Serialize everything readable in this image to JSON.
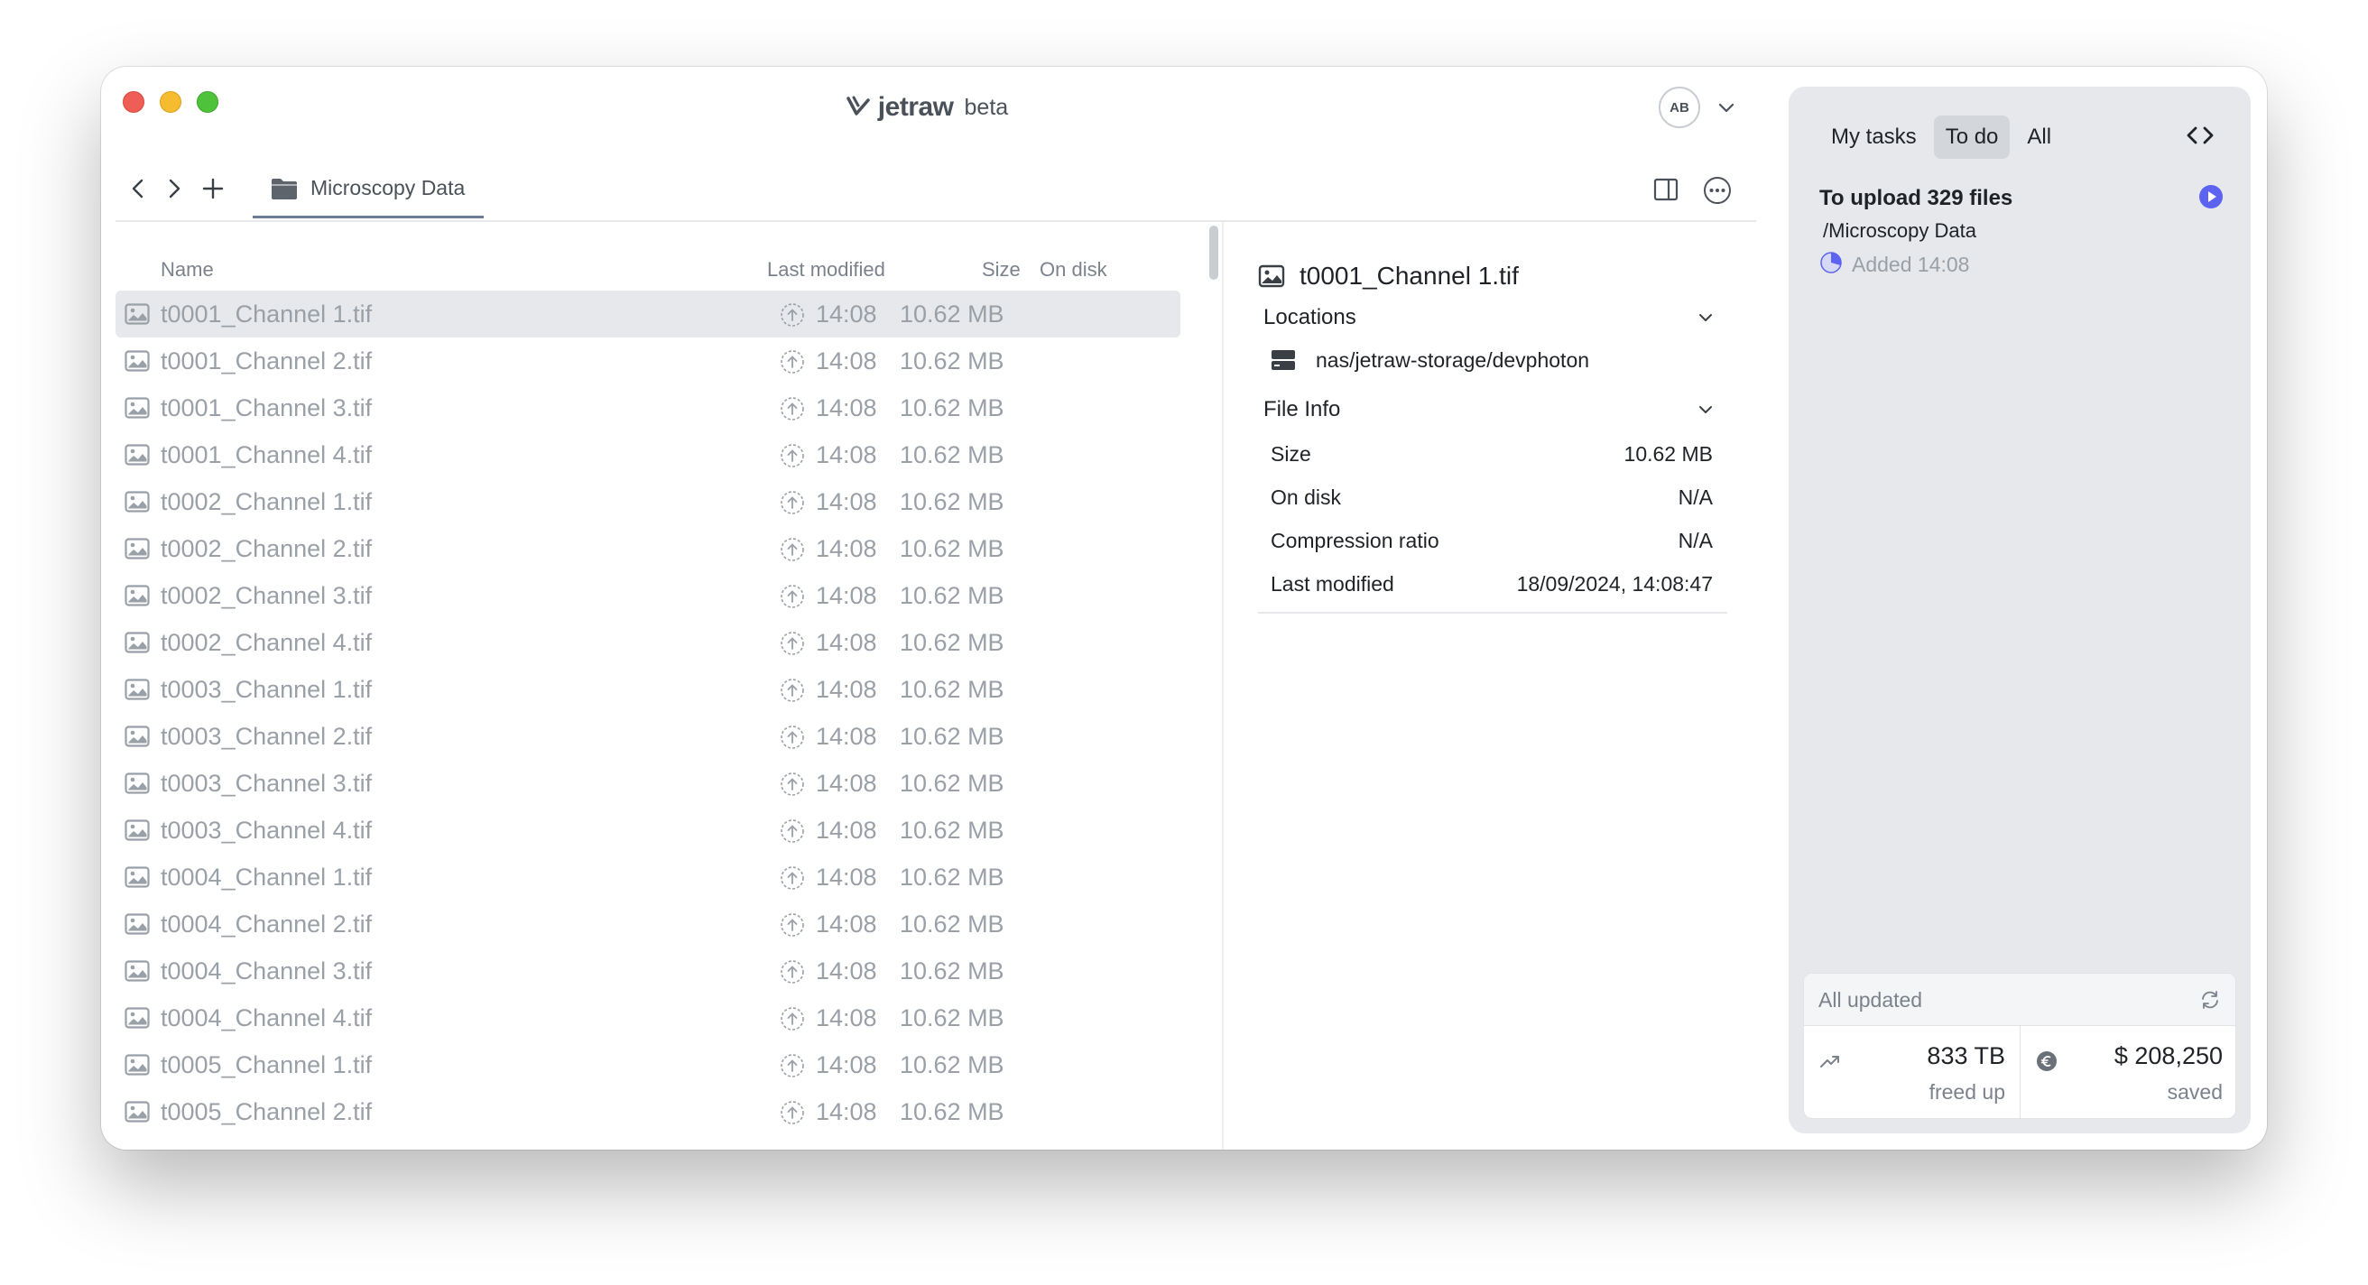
{
  "app": {
    "name": "jetraw",
    "badge": "beta",
    "user_initials": "AB"
  },
  "toolbar": {
    "tab_label": "Microscopy Data"
  },
  "file_list": {
    "columns": {
      "name": "Name",
      "last_modified": "Last modified",
      "size": "Size",
      "on_disk": "On disk"
    },
    "rows": [
      {
        "name": "t0001_Channel 1.tif",
        "time": "14:08",
        "size": "10.62 MB"
      },
      {
        "name": "t0001_Channel 2.tif",
        "time": "14:08",
        "size": "10.62 MB"
      },
      {
        "name": "t0001_Channel 3.tif",
        "time": "14:08",
        "size": "10.62 MB"
      },
      {
        "name": "t0001_Channel 4.tif",
        "time": "14:08",
        "size": "10.62 MB"
      },
      {
        "name": "t0002_Channel 1.tif",
        "time": "14:08",
        "size": "10.62 MB"
      },
      {
        "name": "t0002_Channel 2.tif",
        "time": "14:08",
        "size": "10.62 MB"
      },
      {
        "name": "t0002_Channel 3.tif",
        "time": "14:08",
        "size": "10.62 MB"
      },
      {
        "name": "t0002_Channel 4.tif",
        "time": "14:08",
        "size": "10.62 MB"
      },
      {
        "name": "t0003_Channel 1.tif",
        "time": "14:08",
        "size": "10.62 MB"
      },
      {
        "name": "t0003_Channel 2.tif",
        "time": "14:08",
        "size": "10.62 MB"
      },
      {
        "name": "t0003_Channel 3.tif",
        "time": "14:08",
        "size": "10.62 MB"
      },
      {
        "name": "t0003_Channel 4.tif",
        "time": "14:08",
        "size": "10.62 MB"
      },
      {
        "name": "t0004_Channel 1.tif",
        "time": "14:08",
        "size": "10.62 MB"
      },
      {
        "name": "t0004_Channel 2.tif",
        "time": "14:08",
        "size": "10.62 MB"
      },
      {
        "name": "t0004_Channel 3.tif",
        "time": "14:08",
        "size": "10.62 MB"
      },
      {
        "name": "t0004_Channel 4.tif",
        "time": "14:08",
        "size": "10.62 MB"
      },
      {
        "name": "t0005_Channel 1.tif",
        "time": "14:08",
        "size": "10.62 MB"
      },
      {
        "name": "t0005_Channel 2.tif",
        "time": "14:08",
        "size": "10.62 MB"
      }
    ]
  },
  "detail": {
    "title": "t0001_Channel 1.tif",
    "locations_label": "Locations",
    "location_path": "nas/jetraw-storage/devphoton",
    "file_info_label": "File Info",
    "info": [
      {
        "label": "Size",
        "value": "10.62 MB"
      },
      {
        "label": "On disk",
        "value": "N/A"
      },
      {
        "label": "Compression ratio",
        "value": "N/A"
      },
      {
        "label": "Last modified",
        "value": "18/09/2024, 14:08:47"
      }
    ]
  },
  "tasks": {
    "tabs": [
      {
        "label": "My tasks"
      },
      {
        "label": "To do"
      },
      {
        "label": "All"
      }
    ],
    "active_tab": "To do",
    "task": {
      "title": "To upload 329 files",
      "path": "/Microscopy Data",
      "added": "Added 14:08"
    },
    "stats": {
      "status": "All updated",
      "freed_value": "833 TB",
      "freed_label": "freed up",
      "saved_value": "$ 208,250",
      "saved_label": "saved"
    }
  },
  "colors": {
    "accent": "#5b63f0",
    "selected_row": "#e6e8eb",
    "panel_bg": "#e6e8eb"
  },
  "icons": {
    "file": "image-icon",
    "upload": "upload-circle-icon",
    "folder": "folder-icon",
    "storage": "server-icon",
    "play": "play-circle-icon",
    "refresh": "refresh-icon",
    "trend": "trend-up-icon",
    "currency": "euro-icon"
  }
}
